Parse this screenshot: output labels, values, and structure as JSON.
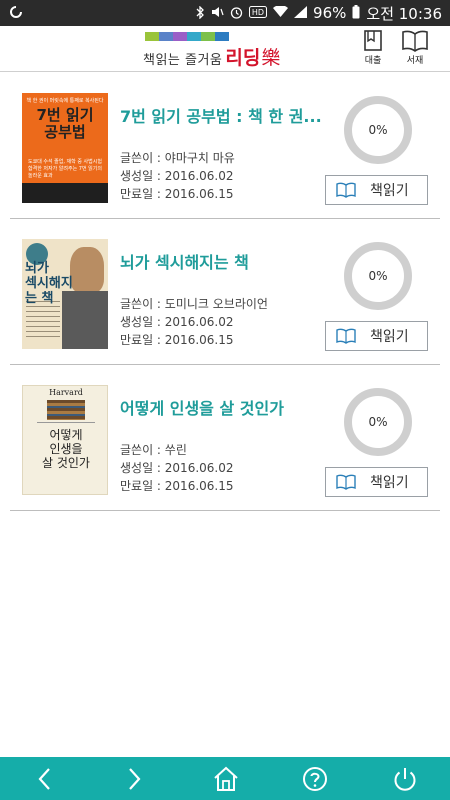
{
  "status_bar": {
    "carrier_icon": "carrier-icon",
    "battery_text": "96%",
    "time": "오전 10:36"
  },
  "header": {
    "logo": {
      "subtitle": "책읽는 즐거움",
      "brand": "리딩",
      "mark": "樂",
      "bar_colors": [
        "#9ac43a",
        "#5a82c8",
        "#9a5fc7",
        "#34a8c9",
        "#7cc04a",
        "#2c7cc1"
      ]
    },
    "loan_label": "대출",
    "shelf_label": "서재"
  },
  "books": [
    {
      "title": "7번 읽기 공부법 : 책 한 권...",
      "author": "글쓴이 : 야마구치 마유",
      "created": "생성일 : 2016.06.02",
      "expires": "만료일 : 2016.06.15",
      "progress": 0,
      "progress_label": "0%",
      "read_label": "책읽기",
      "cover": {
        "top": "책 한 권이 머릿속에 통째로 복사된다",
        "title": "7번 읽기\n공부법",
        "sub": "도쿄대 수석 졸업, 재학 중 사법시험 합격한 저자가 알려주는 7번 읽기의 놀라운 효과"
      }
    },
    {
      "title": "뇌가 섹시해지는 책",
      "author": "글쓴이 : 도미니크 오브라이언",
      "created": "생성일 : 2016.06.02",
      "expires": "만료일 : 2016.06.15",
      "progress": 0,
      "progress_label": "0%",
      "read_label": "책읽기",
      "cover": {
        "title": "뇌가\n섹시해지는 책"
      }
    },
    {
      "title": "어떻게 인생을 살 것인가",
      "author": "글쓴이 : 쑤린",
      "created": "생성일 : 2016.06.02",
      "expires": "만료일 : 2016.06.15",
      "progress": 0,
      "progress_label": "0%",
      "read_label": "책읽기",
      "cover": {
        "brand": "Harvard",
        "title": "어떻게\n인생을\n살 것인가"
      }
    }
  ],
  "bottom_nav": {
    "back_icon": "chevron-left-icon",
    "forward_icon": "chevron-right-icon",
    "home_icon": "home-icon",
    "help_icon": "help-icon",
    "power_icon": "power-icon",
    "color": "#15ada9"
  }
}
